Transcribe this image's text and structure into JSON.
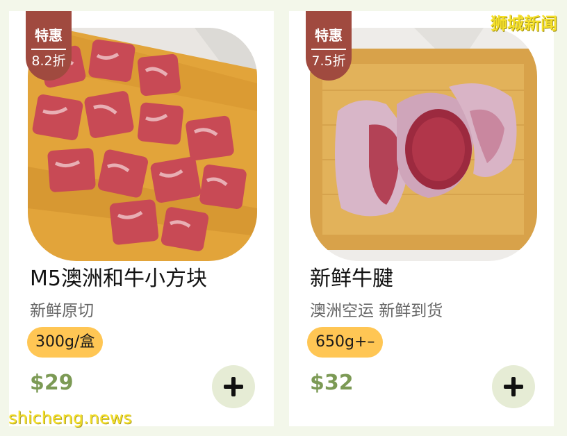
{
  "watermarks": {
    "top": "狮城新闻",
    "bottom": "shicheng.news"
  },
  "products": [
    {
      "badge_label": "特惠",
      "discount": "8.2折",
      "title": "M5澳洲和牛小方块",
      "subtitle": "新鲜原切",
      "weight": "300g/盒",
      "price": "$29",
      "image_icon": "wagyu-cubes-image",
      "add_icon": "plus-icon"
    },
    {
      "badge_label": "特惠",
      "discount": "7.5折",
      "title": "新鲜牛腱",
      "subtitle": "澳洲空运 新鲜到货",
      "weight": "650g+–",
      "price": "$32",
      "image_icon": "beef-shank-image",
      "add_icon": "plus-icon"
    }
  ],
  "colors": {
    "badge": "#a04a3f",
    "price": "#7c9a55",
    "weight_pill": "#ffc654",
    "add_button_bg": "#e6ecd5",
    "background": "#f3f7ea"
  }
}
